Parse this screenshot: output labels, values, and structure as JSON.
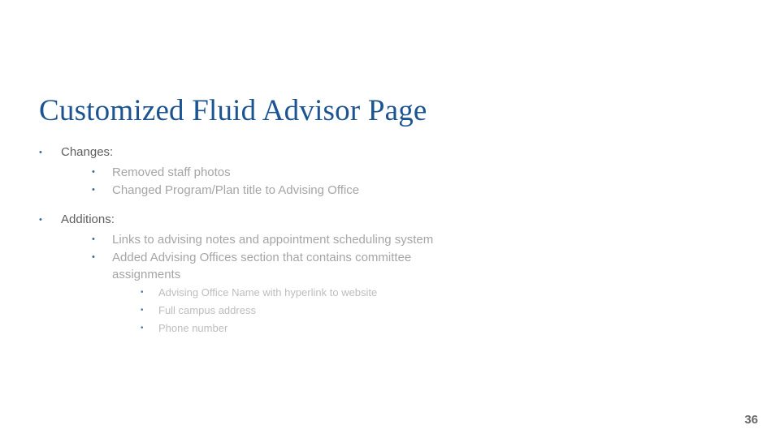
{
  "slide": {
    "page_number": "36",
    "title": "Customized Fluid Advisor Page",
    "accent_color": "#1b5490",
    "level1_text_color": "#5e5e5e",
    "level2_text_color": "#a5a5a5",
    "level3_text_color": "#bdbdbd",
    "bullet_marker": "•",
    "background_color": "#ffffff"
  },
  "header": {
    "line1": "",
    "line2": "",
    "note": "faint white-on-white header text, illegible"
  },
  "groups": [
    {
      "label": "Changes:",
      "items": [
        {
          "text": "Removed staff photos",
          "subitems": []
        },
        {
          "text": "Changed Program/Plan title to Advising Office",
          "subitems": []
        }
      ]
    },
    {
      "label": "Additions:",
      "items": [
        {
          "text": "Links to advising notes and appointment scheduling system",
          "subitems": []
        },
        {
          "text": "Added Advising Offices section that contains committee assignments",
          "subitems": [
            "Advising Office Name with hyperlink to website",
            "Full campus address",
            "Phone number"
          ]
        }
      ]
    }
  ]
}
